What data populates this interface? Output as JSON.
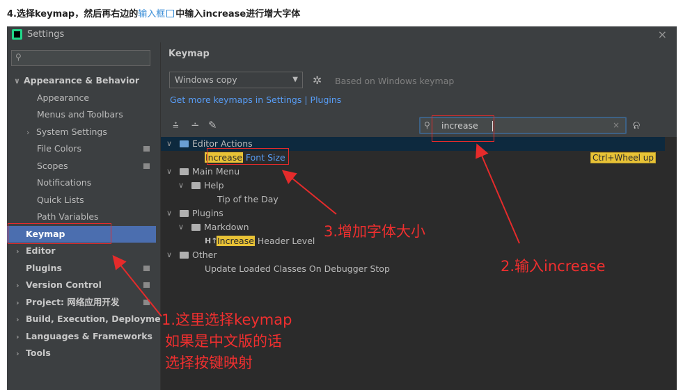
{
  "caption": {
    "prefix": "4.选择keymap，然后再右边的",
    "link": "输入框",
    "suffix": "中输入increase进行增大字体"
  },
  "window": {
    "title": "Settings",
    "close": "×"
  },
  "sidebar": {
    "search_icon": "search-icon",
    "items": [
      {
        "label": "Appearance & Behavior",
        "arrow": "∨"
      },
      {
        "label": "Appearance"
      },
      {
        "label": "Menus and Toolbars"
      },
      {
        "label": "System Settings",
        "arrow": "›"
      },
      {
        "label": "File Colors"
      },
      {
        "label": "Scopes"
      },
      {
        "label": "Notifications"
      },
      {
        "label": "Quick Lists"
      },
      {
        "label": "Path Variables"
      },
      {
        "label": "Keymap"
      },
      {
        "label": "Editor",
        "arrow": "›"
      },
      {
        "label": "Plugins"
      },
      {
        "label": "Version Control",
        "arrow": "›"
      },
      {
        "label": "Project: 网络应用开发",
        "arrow": "›"
      },
      {
        "label": "Build, Execution, Deployment",
        "arrow": "›"
      },
      {
        "label": "Languages & Frameworks",
        "arrow": "›"
      },
      {
        "label": "Tools",
        "arrow": "›"
      }
    ]
  },
  "main": {
    "heading": "Keymap",
    "keymap_select": "Windows copy",
    "based_on": "Based on Windows keymap",
    "plugins_link": "Get more keymaps in Settings | Plugins",
    "search_value": "increase",
    "search_clear": "×"
  },
  "tree": {
    "editor_actions": "Editor Actions",
    "increase_hl": "Increase",
    "font_size": " Font Size",
    "shortcut": "Ctrl+Wheel up",
    "main_menu": "Main Menu",
    "help": "Help",
    "tip": "Tip of the Day",
    "plugins": "Plugins",
    "markdown": "Markdown",
    "h_prefix": "H↑",
    "header_level": " Header Level",
    "other": "Other",
    "update": "Update Loaded Classes On Debugger Stop"
  },
  "annotations": {
    "step1_line1": "1.这里选择keymap",
    "step1_line2": "如果是中文版的话",
    "step1_line3": "选择按键映射",
    "step2": "2.输入increase",
    "step3": "3.增加字体大小",
    "color": "#e52b2b"
  }
}
